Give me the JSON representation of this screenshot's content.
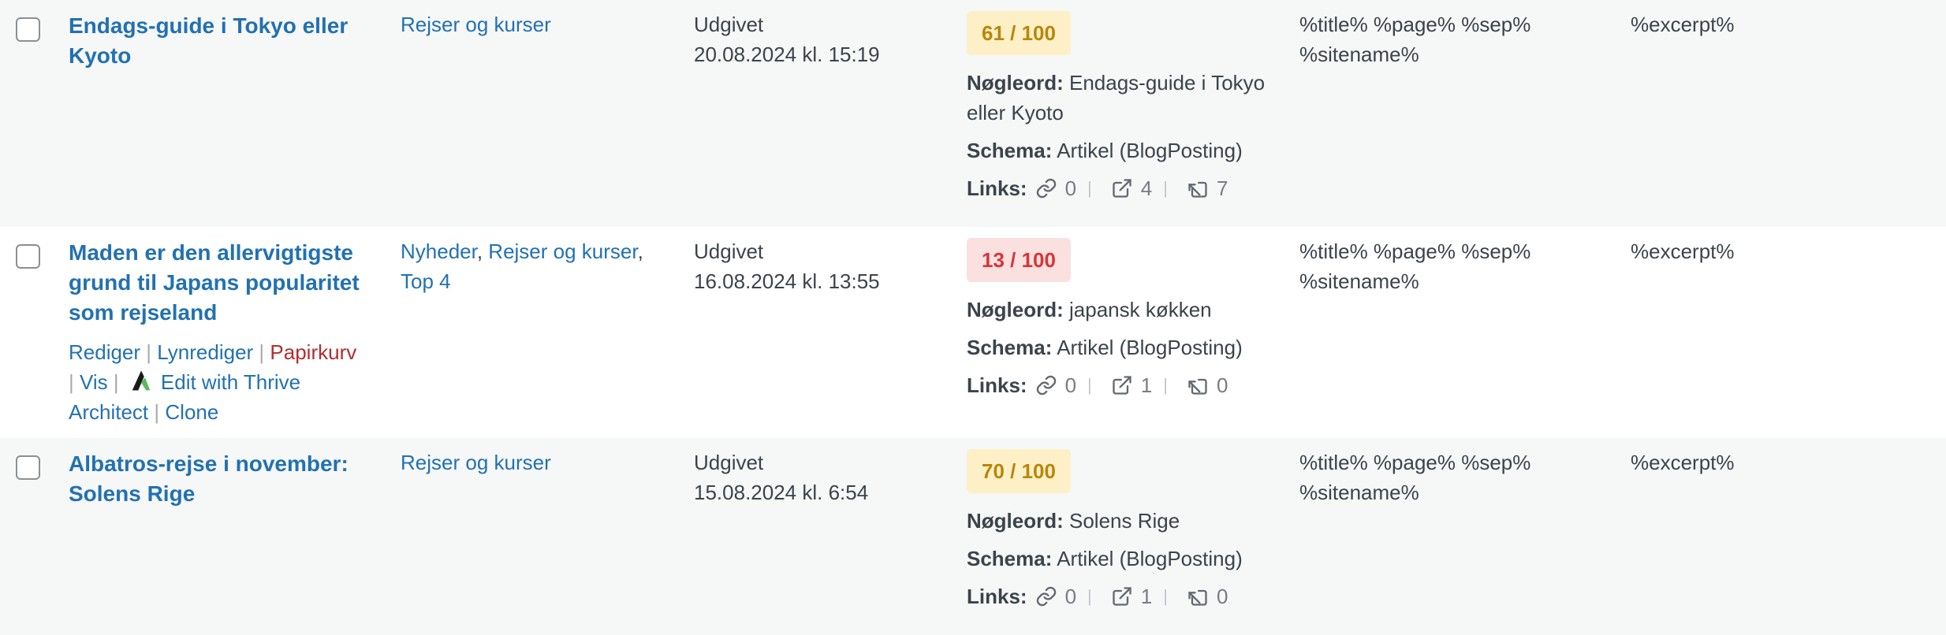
{
  "rows": [
    {
      "title": "Endags-guide i Tokyo eller Kyoto",
      "categories": [
        "Rejser og kurser"
      ],
      "status": "Udgivet",
      "date": "20.08.2024 kl. 15:19",
      "score": "61 / 100",
      "score_color": "#b8860b",
      "keyword_label": "Nøgleord:",
      "keyword": "Endags-guide i Tokyo eller Kyoto",
      "schema_label": "Schema:",
      "schema": "Artikel (BlogPosting)",
      "links_label": "Links:",
      "links": {
        "internal": "0",
        "external": "4",
        "incoming": "7"
      },
      "seo_title": "%title% %page% %sep% %sitename%",
      "seo_desc": "%excerpt%"
    },
    {
      "title": "Maden er den allervigtigste grund til Japans popularitet som rejseland",
      "categories": [
        "Nyheder",
        "Rejser og kurser",
        "Top 4"
      ],
      "status": "Udgivet",
      "date": "16.08.2024 kl. 13:55",
      "score": "13 / 100",
      "score_color": "#d63638",
      "keyword_label": "Nøgleord:",
      "keyword": "japansk køkken",
      "schema_label": "Schema:",
      "schema": "Artikel (BlogPosting)",
      "links_label": "Links:",
      "links": {
        "internal": "0",
        "external": "1",
        "incoming": "0"
      },
      "seo_title": "%title% %page% %sep% %sitename%",
      "seo_desc": "%excerpt%",
      "actions": {
        "edit": "Rediger",
        "quick_edit": "Lynrediger",
        "trash": "Papirkurv",
        "view": "Vis",
        "thrive": "Edit with Thrive Architect",
        "clone": "Clone"
      }
    },
    {
      "title": "Albatros-rejse i november: Solens Rige",
      "categories": [
        "Rejser og kurser"
      ],
      "status": "Udgivet",
      "date": "15.08.2024 kl. 6:54",
      "score": "70 / 100",
      "score_color": "#b8860b",
      "keyword_label": "Nøgleord:",
      "keyword": "Solens Rige",
      "schema_label": "Schema:",
      "schema": "Artikel (BlogPosting)",
      "links_label": "Links:",
      "links": {
        "internal": "0",
        "external": "1",
        "incoming": "0"
      },
      "seo_title": "%title% %page% %sep% %sitename%",
      "seo_desc": "%excerpt%"
    }
  ],
  "icons": [
    "link-icon",
    "external-link-icon",
    "incoming-link-icon",
    "thrive-architect-icon"
  ]
}
